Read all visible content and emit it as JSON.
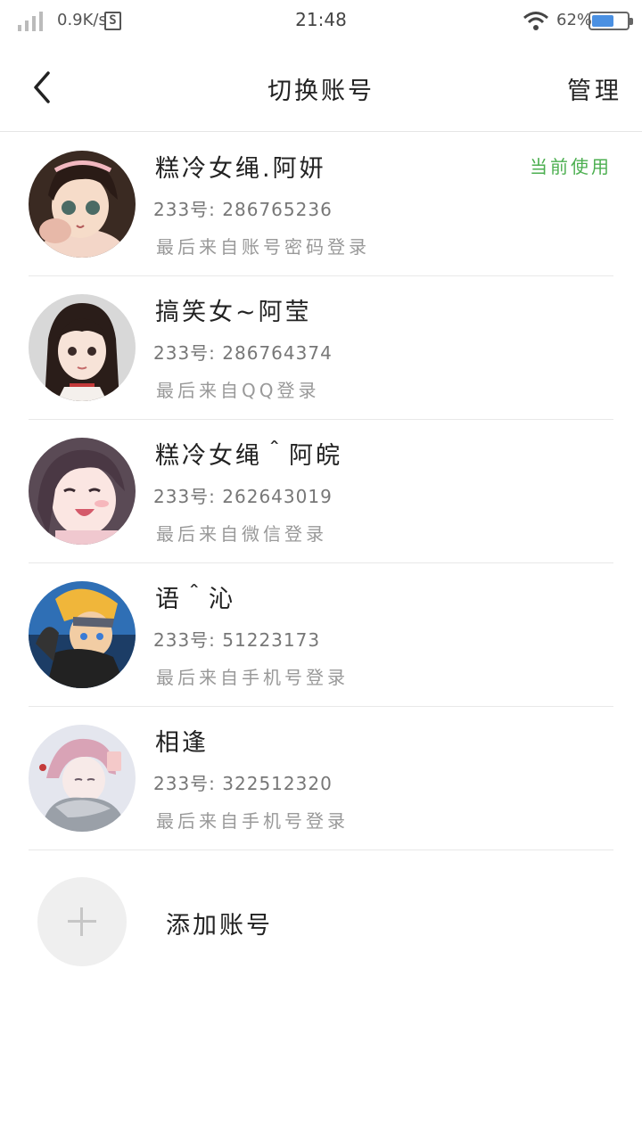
{
  "status_bar": {
    "net_speed": "0.9K/s",
    "s_badge": "S",
    "time": "21:48",
    "battery_percent": "62%",
    "battery_level": 0.62,
    "accent": "#4a90e2"
  },
  "header": {
    "title": "切换账号",
    "manage_label": "管理",
    "back_icon": "chevron-left-icon"
  },
  "accounts": [
    {
      "name": "糕冷女绳.阿妍",
      "id_text": "233号: 286765236",
      "login_text": "最后来自账号密码登录",
      "badge": "当前使用"
    },
    {
      "name": "搞笑女~阿莹",
      "id_text": "233号: 286764374",
      "login_text": "最后来自QQ登录"
    },
    {
      "name": "糕冷女绳＾阿皖",
      "id_text": "233号: 262643019",
      "login_text": "最后来自微信登录"
    },
    {
      "name": "语＾沁",
      "id_text": "233号: 51223173",
      "login_text": "最后来自手机号登录"
    },
    {
      "name": "相逢",
      "id_text": "233号: 322512320",
      "login_text": "最后来自手机号登录"
    }
  ],
  "add_account": {
    "label": "添加账号",
    "icon": "plus-icon"
  },
  "colors": {
    "current_badge": "#4caf50",
    "divider": "#e8e8e8"
  }
}
